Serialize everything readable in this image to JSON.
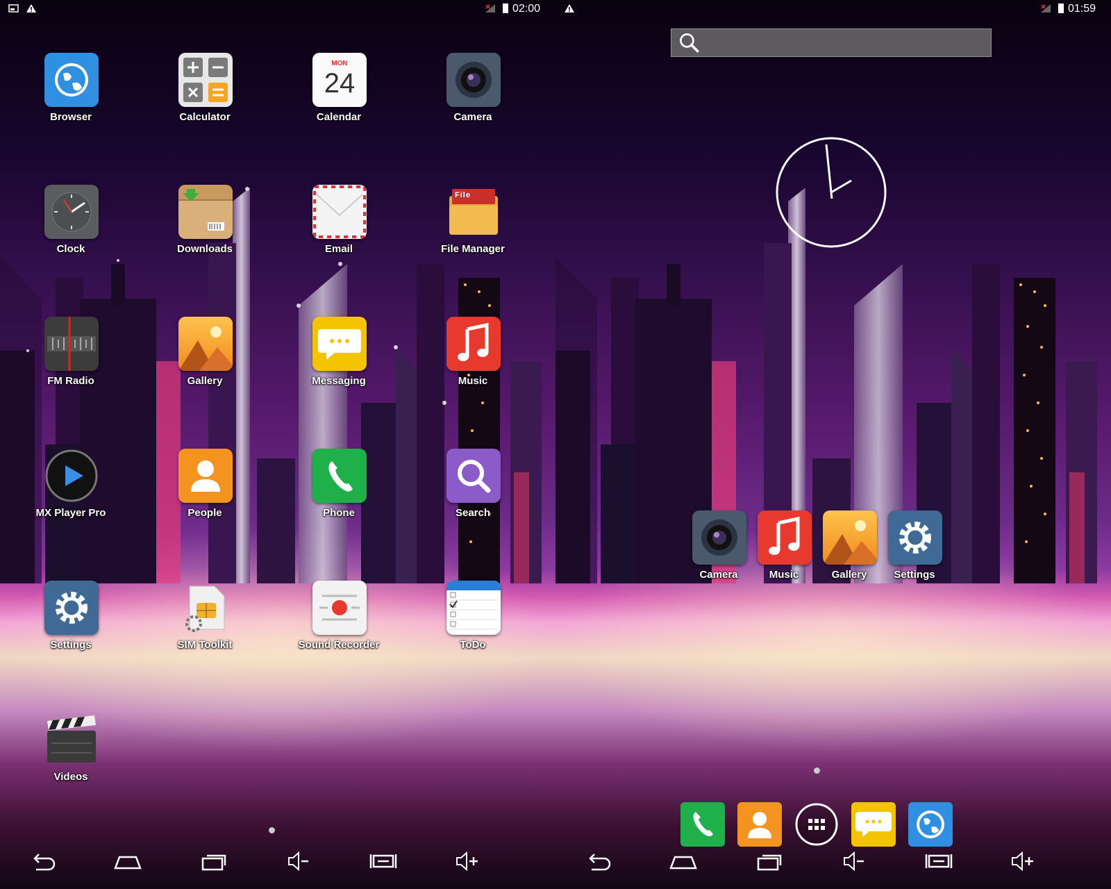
{
  "left": {
    "status": {
      "time": "02:00"
    },
    "apps": [
      {
        "name": "Browser"
      },
      {
        "name": "Calculator"
      },
      {
        "name": "Calendar",
        "month": "MON",
        "day": "24"
      },
      {
        "name": "Camera"
      },
      {
        "name": "Clock"
      },
      {
        "name": "Downloads"
      },
      {
        "name": "Email"
      },
      {
        "name": "File Manager",
        "tab": "File"
      },
      {
        "name": "FM Radio"
      },
      {
        "name": "Gallery"
      },
      {
        "name": "Messaging"
      },
      {
        "name": "Music"
      },
      {
        "name": "MX Player Pro"
      },
      {
        "name": "People"
      },
      {
        "name": "Phone"
      },
      {
        "name": "Search"
      },
      {
        "name": "Settings"
      },
      {
        "name": "SIM Toolkit"
      },
      {
        "name": "Sound Recorder"
      },
      {
        "name": "ToDo"
      },
      {
        "name": "Videos"
      }
    ]
  },
  "right": {
    "status": {
      "time": "01:59"
    },
    "favorites": [
      {
        "name": "Camera"
      },
      {
        "name": "Music"
      },
      {
        "name": "Gallery"
      },
      {
        "name": "Settings"
      }
    ]
  },
  "colors": {
    "accent_blue": "#2f8fe0",
    "phone_green": "#1fb04a",
    "people_orange": "#f39420",
    "msg_yellow": "#f5c400",
    "music_red": "#e8392e",
    "search_purple": "#8b5cc9"
  }
}
